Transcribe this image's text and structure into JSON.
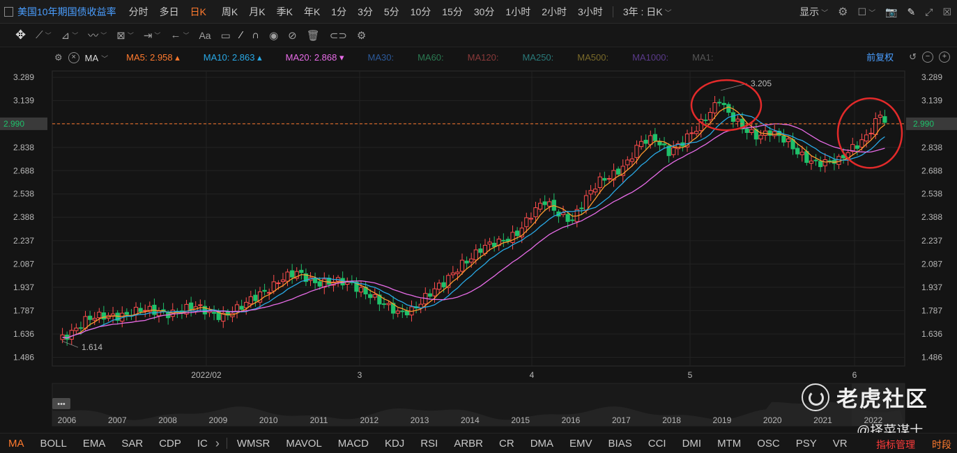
{
  "toolbar": {
    "title": "美国10年期国债收益率",
    "periods": [
      "分时",
      "多日",
      "日K",
      "周K",
      "月K",
      "季K",
      "年K",
      "1分",
      "3分",
      "5分",
      "10分",
      "15分",
      "30分",
      "1小时",
      "2小时",
      "3小时"
    ],
    "active_period": "日K",
    "range_label": "3年 : 日K",
    "display_label": "显示"
  },
  "drawing_tools": [
    "move-icon",
    "line-icon",
    "ray-icon",
    "wave-icon",
    "fib-icon",
    "measure-icon",
    "arrow-icon",
    "text-icon",
    "note-icon",
    "pen-icon",
    "magnet-icon",
    "eye-icon",
    "hide-icon",
    "trash-icon",
    "link-icon",
    "settings-icon"
  ],
  "indicator_bar": {
    "name": "MA",
    "items": [
      {
        "label": "MA5:",
        "value": "2.958",
        "trend": "up",
        "color": "#ff7a2e"
      },
      {
        "label": "MA10:",
        "value": "2.863",
        "trend": "up",
        "color": "#29a9e6"
      },
      {
        "label": "MA20:",
        "value": "2.868",
        "trend": "down",
        "color": "#e86ce8"
      },
      {
        "label": "MA30:",
        "value": "",
        "color": "#2c5a9a"
      },
      {
        "label": "MA60:",
        "value": "",
        "color": "#2b7a52"
      },
      {
        "label": "MA120:",
        "value": "",
        "color": "#8a3a3a"
      },
      {
        "label": "MA250:",
        "value": "",
        "color": "#2a7a7a"
      },
      {
        "label": "MA500:",
        "value": "",
        "color": "#7a6a2a"
      },
      {
        "label": "MA1000:",
        "value": "",
        "color": "#5a3a8a"
      },
      {
        "label": "MA1:",
        "value": "",
        "color": "#555555"
      }
    ],
    "adjust_label": "前复权"
  },
  "chart_data": {
    "type": "candlestick",
    "y_ticks": [
      "3.289",
      "3.139",
      "2.990",
      "2.838",
      "2.688",
      "2.538",
      "2.388",
      "2.237",
      "2.087",
      "1.937",
      "1.787",
      "1.636",
      "1.486"
    ],
    "ylim": [
      1.43,
      3.33
    ],
    "current_price": "2.990",
    "x_labels": [
      "2022/02",
      "3",
      "4",
      "5",
      "6"
    ],
    "annotations": {
      "high": "3.205",
      "low": "1.614"
    },
    "navigator_years": [
      "2006",
      "2007",
      "2008",
      "2009",
      "2010",
      "2011",
      "2012",
      "2013",
      "2014",
      "2015",
      "2016",
      "2017",
      "2018",
      "2019",
      "2020",
      "2021",
      "2022"
    ],
    "colors": {
      "up": "#ff4d4d",
      "down": "#1fc16b",
      "ma5": "#ff9a2e",
      "ma10": "#29a9e6",
      "ma20": "#e86ce8",
      "price_line": "#ff7a2e",
      "circle": "#e32a2a"
    }
  },
  "bottom_tabs": [
    "MA",
    "BOLL",
    "EMA",
    "SAR",
    "CDP",
    "IC",
    "WMSR",
    "MAVOL",
    "MACD",
    "KDJ",
    "RSI",
    "ARBR",
    "CR",
    "DMA",
    "EMV",
    "BIAS",
    "CCI",
    "DMI",
    "MTM",
    "OSC",
    "PSY",
    "VR"
  ],
  "active_tab": "MA",
  "manage_label": "指标管理",
  "time_label": "时段",
  "watermark": {
    "brand": "老虎社区",
    "handle": "@择菜谋士"
  }
}
